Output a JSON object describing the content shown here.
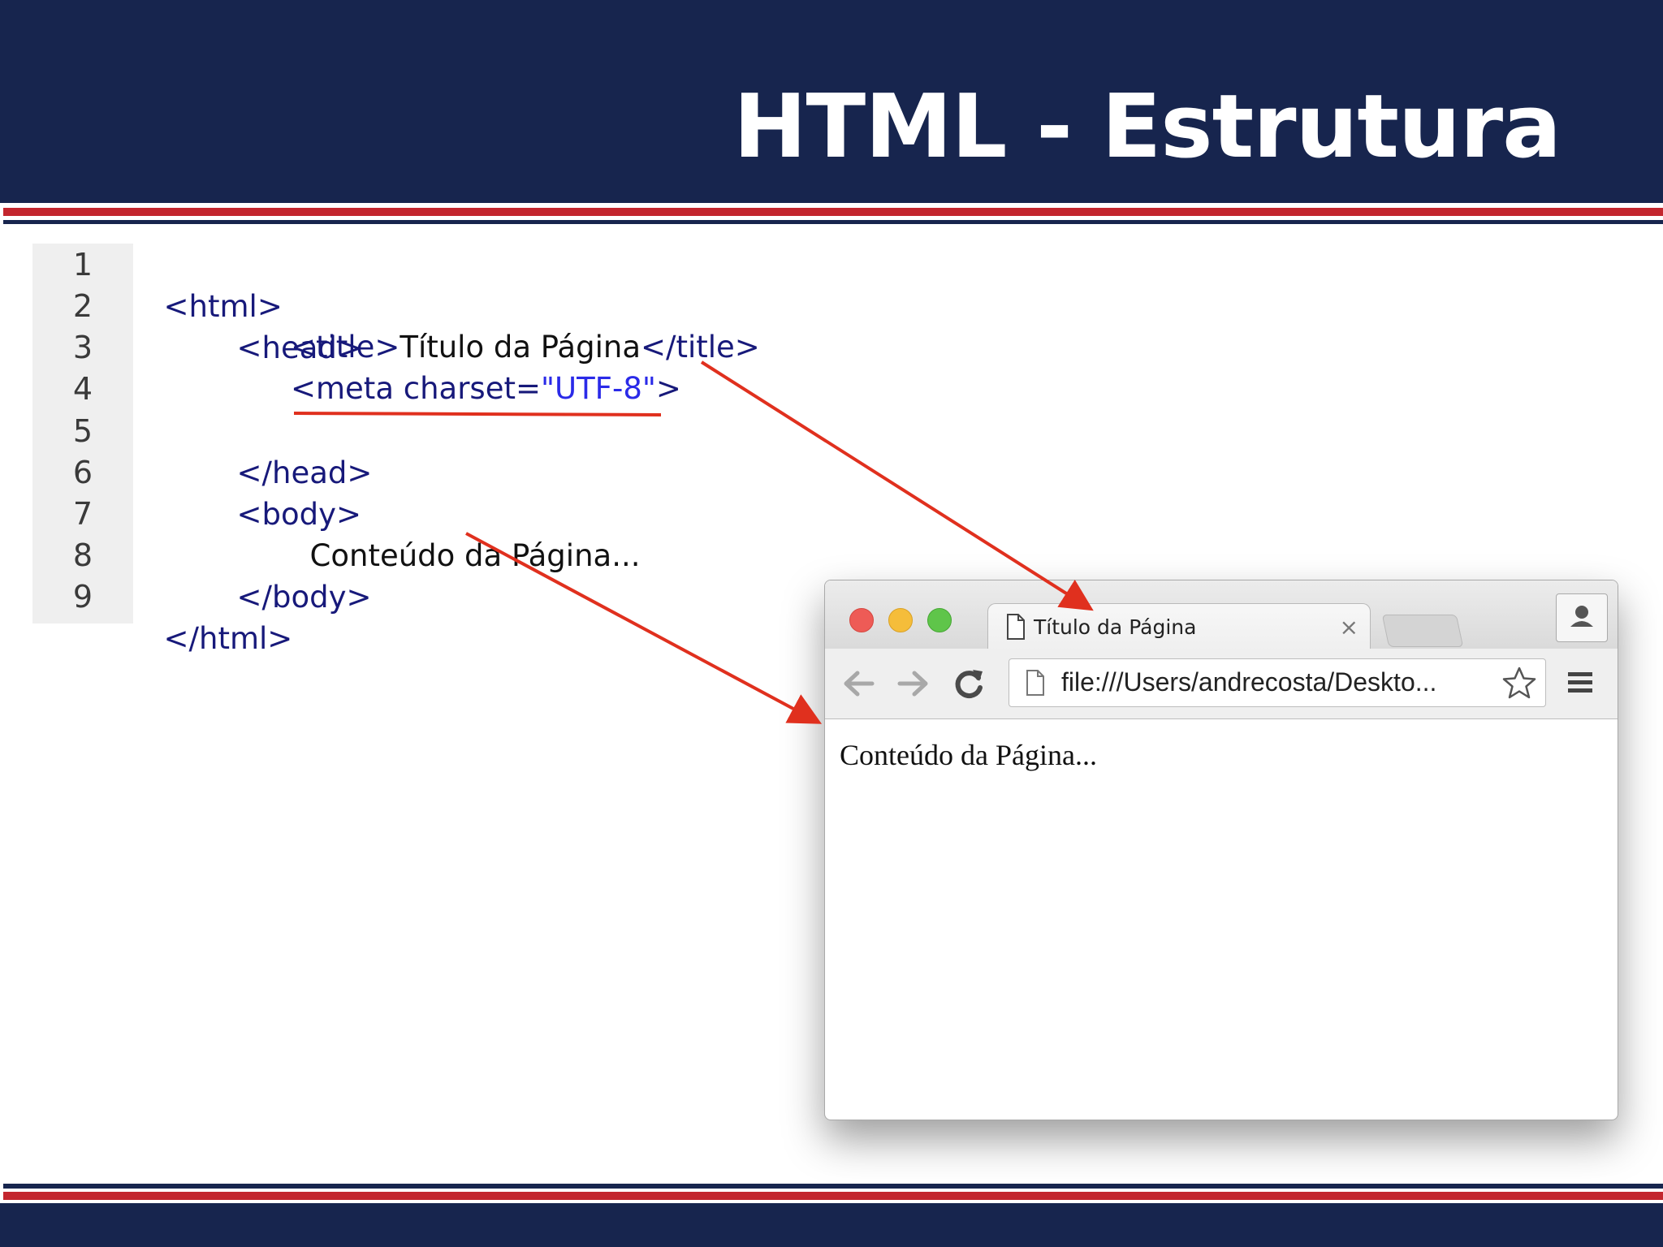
{
  "slide": {
    "title": "HTML - Estrutura"
  },
  "code_editor": {
    "line_numbers": [
      "1",
      "2",
      "3",
      "4",
      "5",
      "6",
      "7",
      "8",
      "9"
    ],
    "lines": {
      "l1_tag": "<html>",
      "l2_tag": "<head>",
      "l3_open": "<title>",
      "l3_text": "Título da Página",
      "l3_close": "</title>",
      "l4_open": "<meta ",
      "l4_attr": "charset=",
      "l4_value": "\"UTF-8\"",
      "l4_close": ">",
      "l5_tag": "</head>",
      "l6_tag": "<body>",
      "l7_text": "Conteúdo da Página...",
      "l8_tag": "</body>",
      "l9_tag": "</html>"
    }
  },
  "browser": {
    "tab_title": "Título da Página",
    "tab_close": "×",
    "url": "file:///Users/andrecosta/Deskto...",
    "page_content": "Conteúdo da Página...",
    "icons": [
      "page-icon",
      "back-arrow-icon",
      "forward-arrow-icon",
      "reload-icon",
      "star-icon",
      "menu-icon",
      "profile-icon"
    ]
  },
  "colors": {
    "header_navy": "#17254e",
    "stripe_red": "#c3262e",
    "annotation_red": "#e0301e",
    "code_tag_blue": "#17197a",
    "code_string_blue": "#2a2ae8"
  }
}
